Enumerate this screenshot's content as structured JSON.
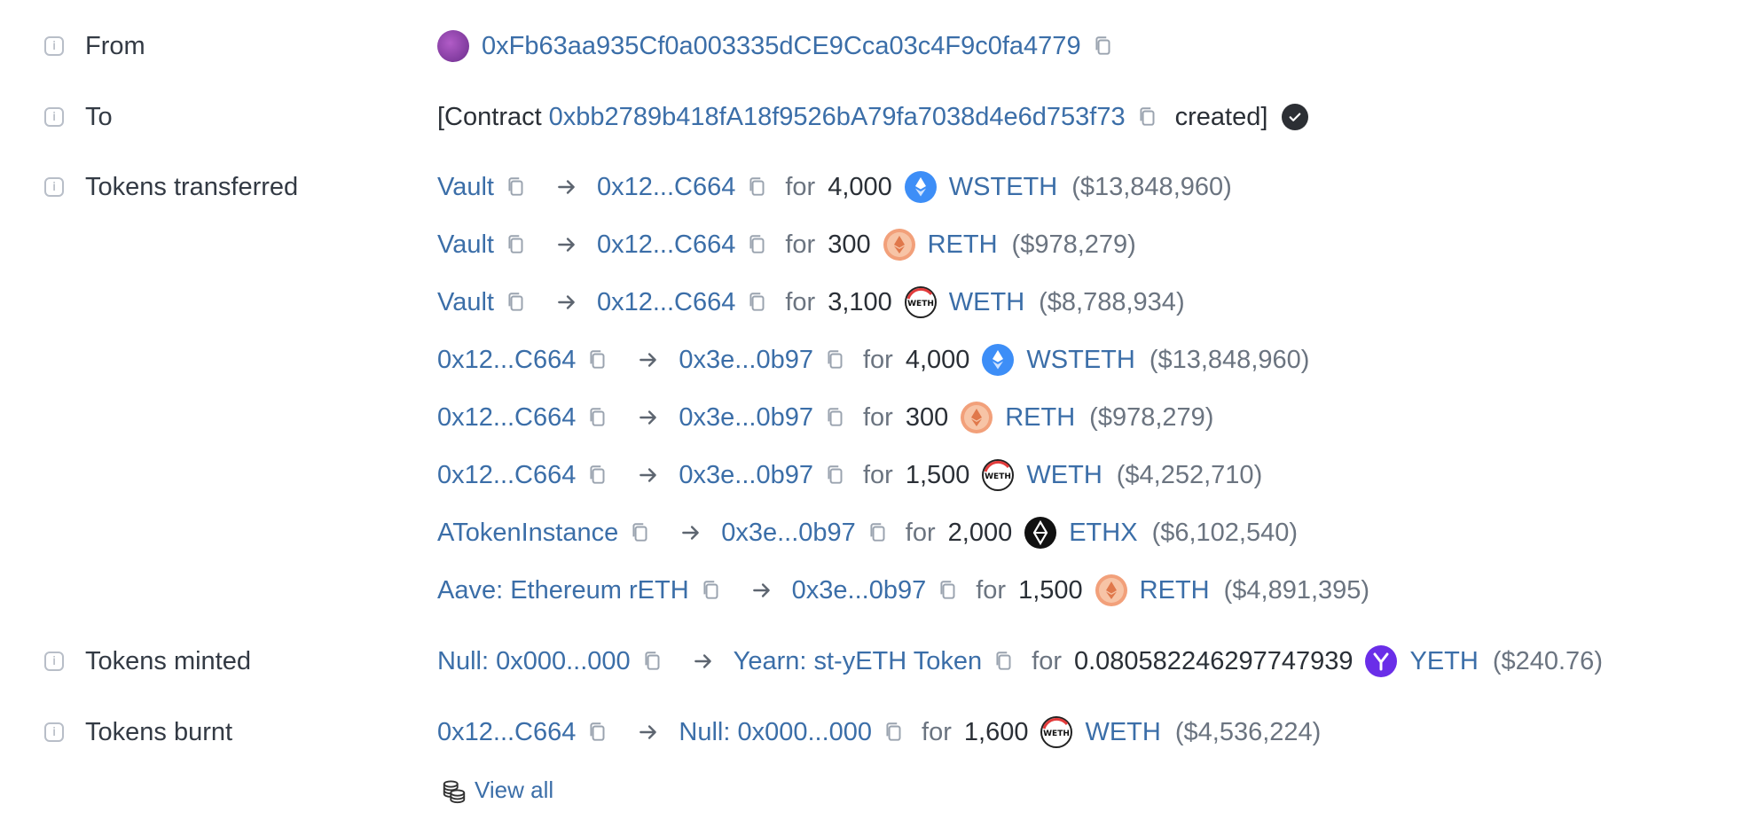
{
  "from": {
    "label": "From",
    "address": "0xFb63aa935Cf0a003335dCE9Cca03c4F9c0fa4779"
  },
  "to": {
    "label": "To",
    "prefix": "[Contract",
    "address": "0xbb2789b418fA18f9526bA79fa7038d4e6d753f73",
    "suffix": "created]"
  },
  "tokens_transferred": {
    "label": "Tokens transferred",
    "rows": [
      {
        "from": "Vault",
        "to": "0x12...C664",
        "for": "for",
        "amount": "4,000",
        "token": "WSTETH",
        "price": "($13,848,960)",
        "icon": "wsteth-icon"
      },
      {
        "from": "Vault",
        "to": "0x12...C664",
        "for": "for",
        "amount": "300",
        "token": "RETH",
        "price": "($978,279)",
        "icon": "reth-icon"
      },
      {
        "from": "Vault",
        "to": "0x12...C664",
        "for": "for",
        "amount": "3,100",
        "token": "WETH",
        "price": "($8,788,934)",
        "icon": "weth-icon"
      },
      {
        "from": "0x12...C664",
        "to": "0x3e...0b97",
        "for": "for",
        "amount": "4,000",
        "token": "WSTETH",
        "price": "($13,848,960)",
        "icon": "wsteth-icon"
      },
      {
        "from": "0x12...C664",
        "to": "0x3e...0b97",
        "for": "for",
        "amount": "300",
        "token": "RETH",
        "price": "($978,279)",
        "icon": "reth-icon"
      },
      {
        "from": "0x12...C664",
        "to": "0x3e...0b97",
        "for": "for",
        "amount": "1,500",
        "token": "WETH",
        "price": "($4,252,710)",
        "icon": "weth-icon"
      },
      {
        "from": "ATokenInstance",
        "to": "0x3e...0b97",
        "for": "for",
        "amount": "2,000",
        "token": "ETHX",
        "price": "($6,102,540)",
        "icon": "ethx-icon"
      },
      {
        "from": "Aave: Ethereum rETH",
        "to": "0x3e...0b97",
        "for": "for",
        "amount": "1,500",
        "token": "RETH",
        "price": "($4,891,395)",
        "icon": "reth-icon"
      }
    ]
  },
  "tokens_minted": {
    "label": "Tokens minted",
    "row": {
      "from": "Null: 0x000...000",
      "to": "Yearn: st-yETH Token",
      "for": "for",
      "amount": "0.080582246297747939",
      "token": "YETH",
      "price": "($240.76)",
      "icon": "yeth-icon"
    }
  },
  "tokens_burnt": {
    "label": "Tokens burnt",
    "row": {
      "from": "0x12...C664",
      "to": "Null: 0x000...000",
      "for": "for",
      "amount": "1,600",
      "token": "WETH",
      "price": "($4,536,224)",
      "icon": "weth-icon"
    }
  },
  "view_all": "View all",
  "colors": {
    "link": "#3b6ea8",
    "muted": "#6b7480",
    "wsteth": "#3d8ef7",
    "reth": "#f2a07a",
    "yeth": "#6a2ee8"
  }
}
